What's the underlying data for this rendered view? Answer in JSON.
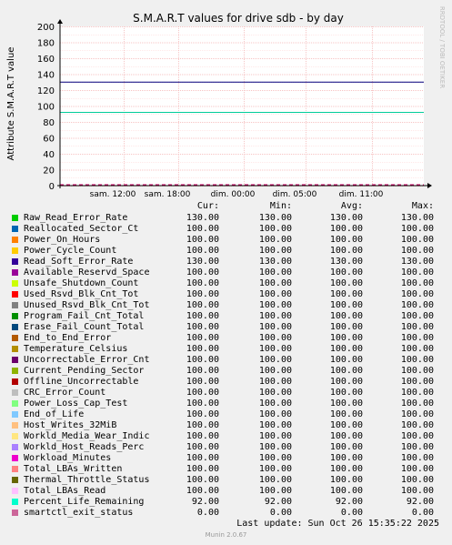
{
  "chart_data": {
    "type": "line",
    "title": "S.M.A.R.T values for drive sdb - by day",
    "ylabel": "Attribute S.M.A.R.T value",
    "ylim": [
      0,
      200
    ],
    "yticks": [
      0,
      20,
      40,
      60,
      80,
      100,
      120,
      140,
      160,
      180,
      200
    ],
    "xtick_labels": [
      "sam. 12:00",
      "sam. 18:00",
      "dim. 00:00",
      "dim. 05:00",
      "dim. 11:00"
    ],
    "grid": true,
    "side_label": "RRDTOOL / TOBI OETIKER",
    "plotted_series": [
      {
        "name": "Raw_Read_Error_Rate",
        "value": 130,
        "color": "#000080"
      },
      {
        "name": "Percent_Life_Remaining",
        "value": 92,
        "color": "#00cc99"
      },
      {
        "name": "smartctl_exit_status",
        "value": 0,
        "color": "#cc0066"
      }
    ]
  },
  "legend": {
    "headers": {
      "cur": "Cur:",
      "min": "Min:",
      "avg": "Avg:",
      "max": "Max:"
    },
    "rows": [
      {
        "name": "Raw_Read_Error_Rate",
        "color": "#00cc00",
        "cur": "130.00",
        "min": "130.00",
        "avg": "130.00",
        "max": "130.00"
      },
      {
        "name": "Reallocated_Sector_Ct",
        "color": "#0066b3",
        "cur": "100.00",
        "min": "100.00",
        "avg": "100.00",
        "max": "100.00"
      },
      {
        "name": "Power_On_Hours",
        "color": "#ff8000",
        "cur": "100.00",
        "min": "100.00",
        "avg": "100.00",
        "max": "100.00"
      },
      {
        "name": "Power_Cycle_Count",
        "color": "#ffcc00",
        "cur": "100.00",
        "min": "100.00",
        "avg": "100.00",
        "max": "100.00"
      },
      {
        "name": "Read_Soft_Error_Rate",
        "color": "#330099",
        "cur": "130.00",
        "min": "130.00",
        "avg": "130.00",
        "max": "130.00"
      },
      {
        "name": "Available_Reservd_Space",
        "color": "#990099",
        "cur": "100.00",
        "min": "100.00",
        "avg": "100.00",
        "max": "100.00"
      },
      {
        "name": "Unsafe_Shutdown_Count",
        "color": "#ccff00",
        "cur": "100.00",
        "min": "100.00",
        "avg": "100.00",
        "max": "100.00"
      },
      {
        "name": "Used_Rsvd_Blk_Cnt_Tot",
        "color": "#ff0000",
        "cur": "100.00",
        "min": "100.00",
        "avg": "100.00",
        "max": "100.00"
      },
      {
        "name": "Unused_Rsvd_Blk_Cnt_Tot",
        "color": "#808080",
        "cur": "100.00",
        "min": "100.00",
        "avg": "100.00",
        "max": "100.00"
      },
      {
        "name": "Program_Fail_Cnt_Total",
        "color": "#008f00",
        "cur": "100.00",
        "min": "100.00",
        "avg": "100.00",
        "max": "100.00"
      },
      {
        "name": "Erase_Fail_Count_Total",
        "color": "#00487d",
        "cur": "100.00",
        "min": "100.00",
        "avg": "100.00",
        "max": "100.00"
      },
      {
        "name": "End_to_End_Error",
        "color": "#b35a00",
        "cur": "100.00",
        "min": "100.00",
        "avg": "100.00",
        "max": "100.00"
      },
      {
        "name": "Temperature_Celsius",
        "color": "#b38f00",
        "cur": "100.00",
        "min": "100.00",
        "avg": "100.00",
        "max": "100.00"
      },
      {
        "name": "Uncorrectable_Error_Cnt",
        "color": "#6b006b",
        "cur": "100.00",
        "min": "100.00",
        "avg": "100.00",
        "max": "100.00"
      },
      {
        "name": "Current_Pending_Sector",
        "color": "#8fb300",
        "cur": "100.00",
        "min": "100.00",
        "avg": "100.00",
        "max": "100.00"
      },
      {
        "name": "Offline_Uncorrectable",
        "color": "#b30000",
        "cur": "100.00",
        "min": "100.00",
        "avg": "100.00",
        "max": "100.00"
      },
      {
        "name": "CRC_Error_Count",
        "color": "#bebebe",
        "cur": "100.00",
        "min": "100.00",
        "avg": "100.00",
        "max": "100.00"
      },
      {
        "name": "Power_Loss_Cap_Test",
        "color": "#80ff80",
        "cur": "100.00",
        "min": "100.00",
        "avg": "100.00",
        "max": "100.00"
      },
      {
        "name": "End_of_Life",
        "color": "#80c9ff",
        "cur": "100.00",
        "min": "100.00",
        "avg": "100.00",
        "max": "100.00"
      },
      {
        "name": "Host_Writes_32MiB",
        "color": "#ffc080",
        "cur": "100.00",
        "min": "100.00",
        "avg": "100.00",
        "max": "100.00"
      },
      {
        "name": "Workld_Media_Wear_Indic",
        "color": "#ffe680",
        "cur": "100.00",
        "min": "100.00",
        "avg": "100.00",
        "max": "100.00"
      },
      {
        "name": "Workld_Host_Reads_Perc",
        "color": "#aa80ff",
        "cur": "100.00",
        "min": "100.00",
        "avg": "100.00",
        "max": "100.00"
      },
      {
        "name": "Workload_Minutes",
        "color": "#ee00cc",
        "cur": "100.00",
        "min": "100.00",
        "avg": "100.00",
        "max": "100.00"
      },
      {
        "name": "Total_LBAs_Written",
        "color": "#ff8080",
        "cur": "100.00",
        "min": "100.00",
        "avg": "100.00",
        "max": "100.00"
      },
      {
        "name": "Thermal_Throttle_Status",
        "color": "#666600",
        "cur": "100.00",
        "min": "100.00",
        "avg": "100.00",
        "max": "100.00"
      },
      {
        "name": "Total_LBAs_Read",
        "color": "#ffbfff",
        "cur": "100.00",
        "min": "100.00",
        "avg": "100.00",
        "max": "100.00"
      },
      {
        "name": "Percent_Life_Remaining",
        "color": "#00ffcc",
        "cur": "92.00",
        "min": "92.00",
        "avg": "92.00",
        "max": "92.00"
      },
      {
        "name": "smartctl_exit_status",
        "color": "#cc6699",
        "cur": "0.00",
        "min": "0.00",
        "avg": "0.00",
        "max": "0.00"
      }
    ]
  },
  "footer": {
    "last_update": "Last update: Sun Oct 26 15:35:22 2025",
    "munin": "Munin 2.0.67"
  }
}
